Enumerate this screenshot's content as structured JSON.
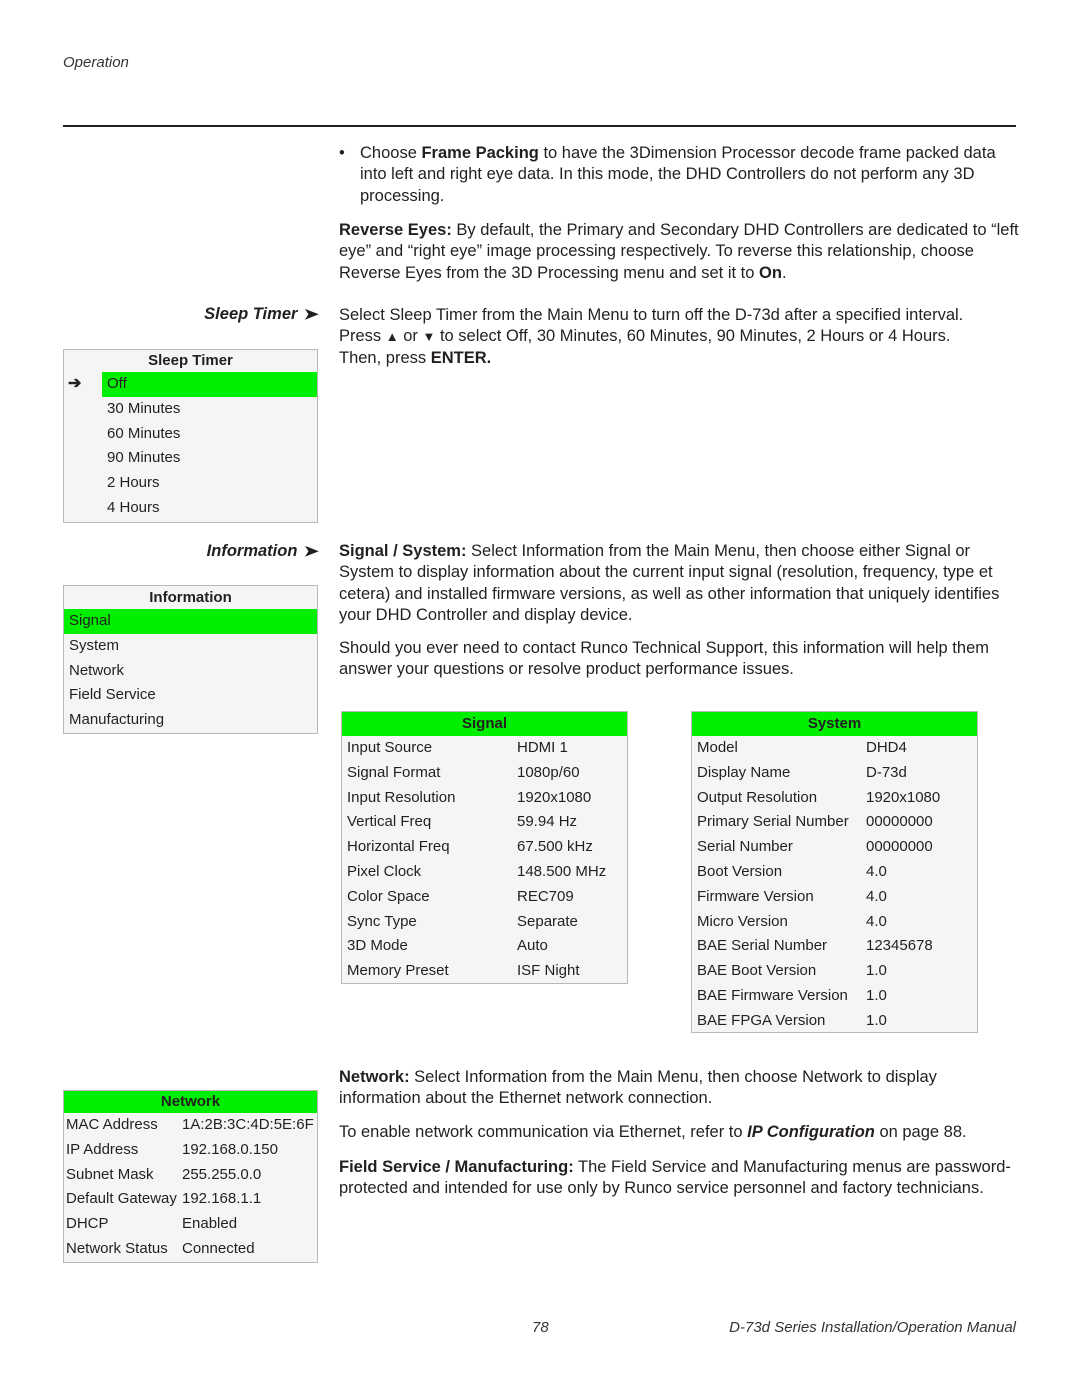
{
  "header": {
    "running_head": "Operation"
  },
  "intro": {
    "bullet": {
      "pre": "Choose ",
      "bold": "Frame Packing",
      "post": " to have the 3Dimension Processor decode frame packed data into left and right eye data. In this mode, the DHD Controllers do not perform any 3D processing."
    },
    "reverse_eyes": {
      "bold": "Reverse Eyes:",
      "text": " By default, the Primary and Secondary DHD Controllers are dedicated to “left eye” and “right eye” image processing respectively. To reverse this relationship, choose Reverse Eyes from the 3D Processing menu and set it to ",
      "bold_end": "On",
      "end": "."
    }
  },
  "sleep_timer": {
    "side_heading": "Sleep Timer",
    "para_line1": "Select Sleep Timer from the Main Menu to turn off the D-73d after a specified interval.",
    "para_press": "Press ",
    "up_symbol": "▲",
    "or": " or ",
    "down_symbol": "▼",
    "para_line2_rest": " to select Off, 30 Minutes, 60 Minutes, 90 Minutes, 2 Hours or 4 Hours.",
    "para_then": "Then, press ",
    "para_enter": "ENTER.",
    "menu": {
      "title": "Sleep Timer",
      "pointer": "➔",
      "items": [
        "Off",
        "30 Minutes",
        "60 Minutes",
        "90 Minutes",
        "2 Hours",
        "4 Hours"
      ],
      "selected_index": 0
    }
  },
  "information": {
    "side_heading": "Information",
    "signal_system_para": {
      "bold": "Signal / System:",
      "text": " Select Information from the Main Menu, then choose either Signal or System to display information about the current input signal (resolution, frequency, type et cetera) and installed firmware versions, as well as other information that uniquely identifies your DHD Controller and display device."
    },
    "support_para": "Should you ever need to contact Runco Technical Support, this information will help them answer your questions or resolve product performance issues.",
    "menu": {
      "title": "Information",
      "items": [
        "Signal",
        "System",
        "Network",
        "Field Service",
        "Manufacturing"
      ],
      "selected_index": 0
    },
    "signal_table": {
      "title": "Signal",
      "rows": [
        {
          "key": "Input Source",
          "value": "HDMI 1"
        },
        {
          "key": "Signal Format",
          "value": "1080p/60"
        },
        {
          "key": "Input Resolution",
          "value": "1920x1080"
        },
        {
          "key": "Vertical Freq",
          "value": "59.94 Hz"
        },
        {
          "key": "Horizontal Freq",
          "value": "67.500 kHz"
        },
        {
          "key": "Pixel Clock",
          "value": "148.500 MHz"
        },
        {
          "key": "Color Space",
          "value": "REC709"
        },
        {
          "key": "Sync Type",
          "value": "Separate"
        },
        {
          "key": "3D Mode",
          "value": "Auto"
        },
        {
          "key": "Memory Preset",
          "value": "ISF Night"
        }
      ]
    },
    "system_table": {
      "title": "System",
      "rows": [
        {
          "key": "Model",
          "value": "DHD4"
        },
        {
          "key": "Display Name",
          "value": "D-73d"
        },
        {
          "key": "Output Resolution",
          "value": "1920x1080"
        },
        {
          "key": "Primary Serial Number",
          "value": "00000000"
        },
        {
          "key": "Serial Number",
          "value": "00000000"
        },
        {
          "key": "Boot Version",
          "value": "4.0"
        },
        {
          "key": "Firmware Version",
          "value": "4.0"
        },
        {
          "key": "Micro Version",
          "value": "4.0"
        },
        {
          "key": "BAE Serial Number",
          "value": "12345678"
        },
        {
          "key": "BAE Boot Version",
          "value": "1.0"
        },
        {
          "key": "BAE Firmware Version",
          "value": "1.0"
        },
        {
          "key": "BAE FPGA Version",
          "value": "1.0"
        }
      ]
    },
    "network_para": {
      "bold": "Network:",
      "text": " Select Information from the Main Menu, then choose Network to display information about the Ethernet network connection."
    },
    "ip_para": {
      "pre": "To enable network communication via Ethernet, refer to ",
      "link": "IP Configuration",
      "post": " on page 88."
    },
    "field_service_para": {
      "bold": "Field Service / Manufacturing:",
      "text": " The Field Service and Manufacturing menus are password-protected and intended for use only by Runco service personnel and factory technicians."
    },
    "network_table": {
      "title": "Network",
      "rows": [
        {
          "key": "MAC Address",
          "value": "1A:2B:3C:4D:5E:6F"
        },
        {
          "key": "IP Address",
          "value": "192.168.0.150"
        },
        {
          "key": "Subnet Mask",
          "value": "255.255.0.0"
        },
        {
          "key": "Default Gateway",
          "value": "192.168.1.1"
        },
        {
          "key": "DHCP",
          "value": "Enabled"
        },
        {
          "key": "Network Status",
          "value": "Connected"
        }
      ]
    }
  },
  "footer": {
    "page_number": "78",
    "manual_title": "D-73d Series Installation/Operation Manual"
  },
  "colors": {
    "highlight_green": "#00ee00",
    "menu_background": "#f5f5f5",
    "menu_border": "#b9b9b9"
  }
}
